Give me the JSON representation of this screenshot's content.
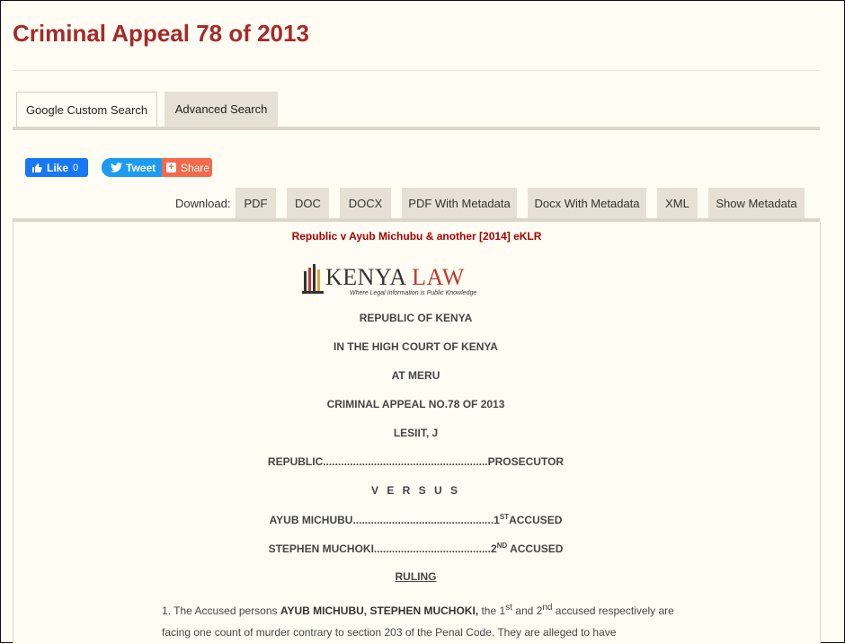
{
  "page_title": "Criminal Appeal 78 of 2013",
  "tabs": [
    {
      "label": "Google Custom Search"
    },
    {
      "label": "Advanced Search"
    }
  ],
  "social": {
    "like_label": "Like",
    "like_count": "0",
    "tweet_label": "Tweet",
    "share_label": "Share"
  },
  "download": {
    "label": "Download:",
    "buttons": [
      "PDF",
      "DOC",
      "DOCX",
      "PDF With Metadata",
      "Docx With Metadata",
      "XML",
      "Show Metadata"
    ]
  },
  "document": {
    "citation": "Republic v Ayub Michubu & another [2014] eKLR",
    "logo": {
      "word1": "KENYA",
      "word2": "LAW",
      "tagline": "Where Legal Information is Public Knowledge"
    },
    "header_lines": [
      "REPUBLIC OF KENYA",
      "IN THE HIGH COURT OF KENYA",
      "AT MERU",
      "CRIMINAL APPEAL NO.78 OF 2013",
      "LESIIT, J"
    ],
    "prosecutor_line": "REPUBLIC.......................................................PROSECUTOR",
    "versus": "V E R S U S",
    "accused_1": {
      "name": "AYUB MICHUBU...............................................1",
      "ordinal_sup": "ST",
      "role": "ACCUSED"
    },
    "accused_2": {
      "name": "STEPHEN MUCHOKI.......................................2",
      "ordinal_sup": "ND",
      "role": " ACCUSED"
    },
    "ruling_heading": "RULING",
    "para1": {
      "number": "1.",
      "prefix": " The Accused persons ",
      "names": "AYUB MICHUBU, STEPHEN MUCHOKI,",
      "mid1": " the 1",
      "sup1": "st",
      "mid2": " and 2",
      "sup2": "nd",
      "rest": " accused respectively are facing one count of murder contrary to section 203 of the Penal Code.   They are alleged to have"
    }
  }
}
